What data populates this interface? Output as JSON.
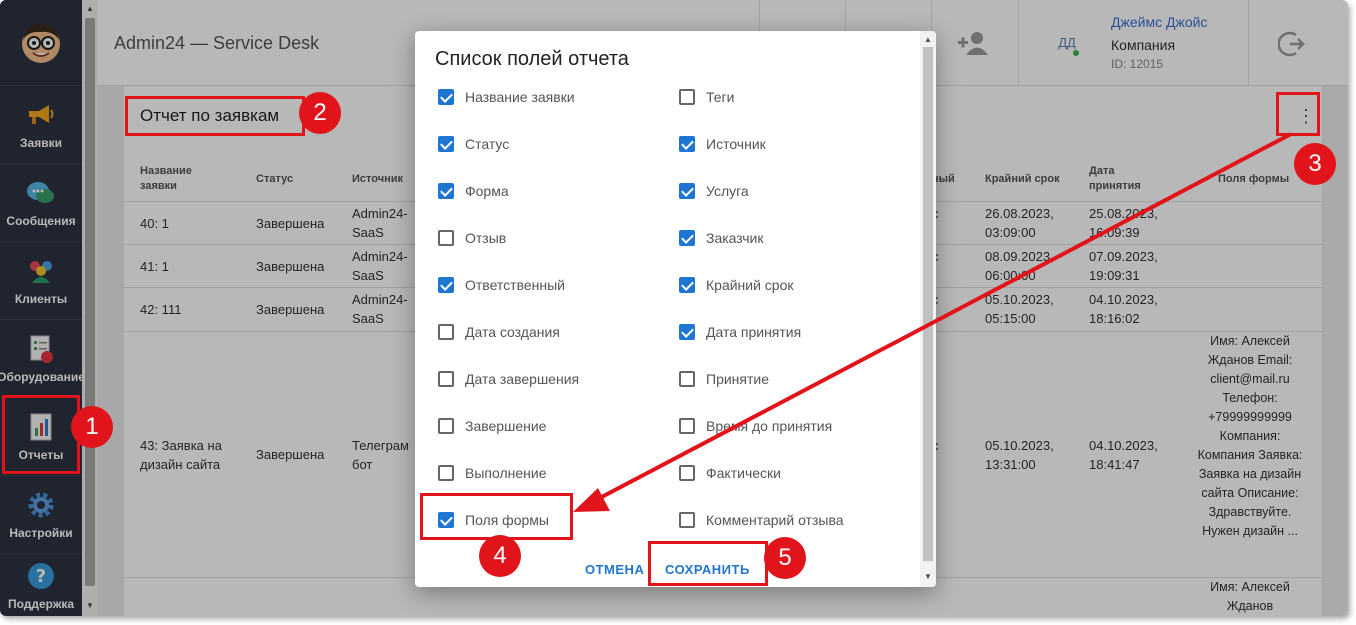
{
  "app": {
    "title": "Admin24 — Service Desk"
  },
  "sidebar": {
    "items": [
      {
        "label": "Заявки",
        "icon": "megaphone-icon"
      },
      {
        "label": "Сообщения",
        "icon": "chat-bubbles-icon"
      },
      {
        "label": "Клиенты",
        "icon": "users-icon"
      },
      {
        "label": "Оборудование",
        "icon": "equipment-checklist-icon"
      },
      {
        "label": "Отчеты",
        "icon": "report-chart-icon"
      },
      {
        "label": "Настройки",
        "icon": "gear-icon"
      },
      {
        "label": "Поддержка",
        "icon": "help-icon"
      }
    ]
  },
  "header": {
    "user": {
      "initials": "ДД",
      "name": "Джеймс Джойс",
      "company": "Компания",
      "id": "ID: 12015"
    }
  },
  "report": {
    "title": "Отчет по заявкам",
    "columns": [
      "Название заявки",
      "Статус",
      "Источник",
      "ный",
      "Крайний срок",
      "Дата принятия",
      "Поля формы"
    ],
    "rows": [
      {
        "name": "40: 1",
        "status": "Завершена",
        "source": "Admin24-SaaS",
        "partial": "с",
        "deadline": "26.08.2023, 03:09:00",
        "accepted": "25.08.2023, 16:09:39",
        "form": ""
      },
      {
        "name": "41: 1",
        "status": "Завершена",
        "source": "Admin24-SaaS",
        "partial": "с",
        "deadline": "08.09.2023, 06:00:00",
        "accepted": "07.09.2023, 19:09:31",
        "form": ""
      },
      {
        "name": "42: 111",
        "status": "Завершена",
        "source": "Admin24-SaaS",
        "partial": "с",
        "deadline": "05.10.2023, 05:15:00",
        "accepted": "04.10.2023, 18:16:02",
        "form": ""
      },
      {
        "name": "43: Заявка на дизайн сайта",
        "status": "Завершена",
        "source": "Телеграм бот",
        "partial": "с",
        "deadline": "05.10.2023, 13:31:00",
        "accepted": "04.10.2023, 18:41:47",
        "form": "Имя: Алексей Жданов Email: client@mail.ru Телефон: +79999999999 Компания: Компания Заявка: Заявка на дизайн сайта Описание: Здравствуйте. Нужен дизайн ..."
      },
      {
        "name": "",
        "status": "",
        "source": "",
        "partial": "",
        "deadline": "",
        "accepted": "",
        "form": "Имя: Алексей Жданов"
      }
    ]
  },
  "dialog": {
    "title": "Список полей отчета",
    "left": [
      {
        "label": "Название заявки",
        "checked": true
      },
      {
        "label": "Статус",
        "checked": true
      },
      {
        "label": "Форма",
        "checked": true
      },
      {
        "label": "Отзыв",
        "checked": false
      },
      {
        "label": "Ответственный",
        "checked": true
      },
      {
        "label": "Дата создания",
        "checked": false
      },
      {
        "label": "Дата завершения",
        "checked": false
      },
      {
        "label": "Завершение",
        "checked": false
      },
      {
        "label": "Выполнение",
        "checked": false
      },
      {
        "label": "Поля формы",
        "checked": true
      }
    ],
    "right": [
      {
        "label": "Теги",
        "checked": false
      },
      {
        "label": "Источник",
        "checked": true
      },
      {
        "label": "Услуга",
        "checked": true
      },
      {
        "label": "Заказчик",
        "checked": true
      },
      {
        "label": "Крайний срок",
        "checked": true
      },
      {
        "label": "Дата принятия",
        "checked": true
      },
      {
        "label": "Принятие",
        "checked": false
      },
      {
        "label": "Время до принятия",
        "checked": false
      },
      {
        "label": "Фактически",
        "checked": false
      },
      {
        "label": "Комментарий отзыва",
        "checked": false
      }
    ],
    "cancel": "ОТМЕНА",
    "save": "СОХРАНИТЬ"
  },
  "annotations": {
    "color": "#e2141b",
    "badges": [
      "1",
      "2",
      "3",
      "4",
      "5"
    ]
  }
}
